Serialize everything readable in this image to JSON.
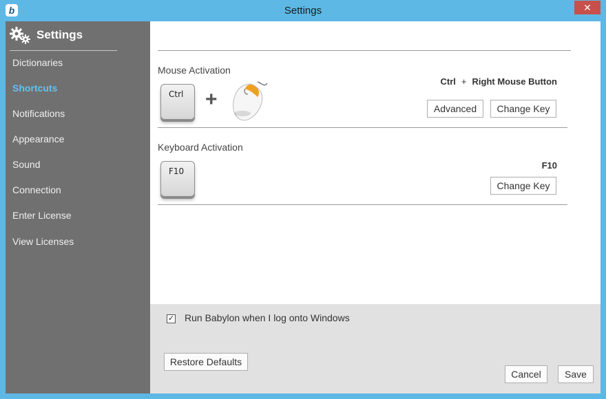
{
  "window": {
    "title": "Settings",
    "close_label": "✕",
    "logo_letter": "b"
  },
  "sidebar": {
    "title": "Settings",
    "items": [
      {
        "label": "Dictionaries",
        "active": false
      },
      {
        "label": "Shortcuts",
        "active": true
      },
      {
        "label": "Notifications",
        "active": false
      },
      {
        "label": "Appearance",
        "active": false
      },
      {
        "label": "Sound",
        "active": false
      },
      {
        "label": "Connection",
        "active": false
      },
      {
        "label": "Enter License",
        "active": false
      },
      {
        "label": "View Licenses",
        "active": false
      }
    ]
  },
  "mouse_activation": {
    "label": "Mouse Activation",
    "key_label": "Ctrl",
    "plus": "+",
    "shortcut_key": "Ctrl",
    "shortcut_plus": "+",
    "shortcut_button": "Right Mouse Button",
    "advanced_label": "Advanced",
    "change_key_label": "Change Key"
  },
  "keyboard_activation": {
    "label": "Keyboard Activation",
    "key_label": "F10",
    "shortcut": "F10",
    "change_key_label": "Change Key"
  },
  "footer": {
    "run_on_startup_label": "Run Babylon when I log onto Windows",
    "run_on_startup_checked": true,
    "checkmark": "✓",
    "restore_label": "Restore Defaults",
    "cancel_label": "Cancel",
    "save_label": "Save"
  },
  "colors": {
    "titlebar": "#5eb8e6",
    "sidebar": "#707070",
    "active_nav": "#5fc3f4",
    "close": "#c7504b",
    "mouse_accent": "#f0a020"
  },
  "icons": {
    "settings": "gear-icon",
    "mouse": "mouse-icon",
    "close": "close-icon"
  }
}
